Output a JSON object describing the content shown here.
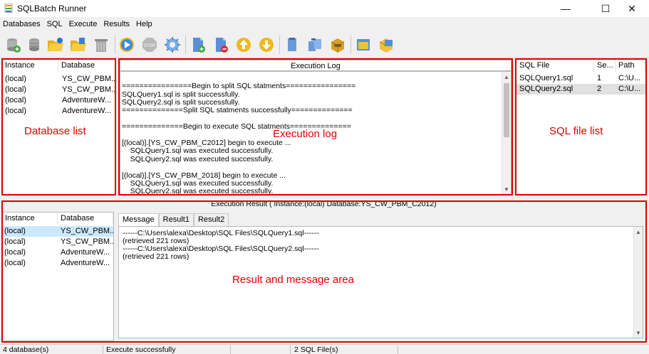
{
  "window": {
    "title": "SQLBatch Runner",
    "minimize": "—",
    "maximize": "☐",
    "close": "✕"
  },
  "menu": [
    "Databases",
    "SQL",
    "Execute",
    "Results",
    "Help"
  ],
  "database_list": {
    "headers": [
      "Instance",
      "Database"
    ],
    "rows": [
      [
        "(local)",
        "YS_CW_PBM..."
      ],
      [
        "(local)",
        "YS_CW_PBM..."
      ],
      [
        "(local)",
        "AdventureW..."
      ],
      [
        "(local)",
        "AdventureW..."
      ]
    ],
    "annotation": "Database list"
  },
  "execution_log": {
    "header": "Execution Log",
    "lines": [
      "================Begin to split SQL statments================",
      "SQLQuery1.sql is split successfully.",
      "SQLQuery2.sql is split successfully.",
      "==============Split SQL statments successfully==============",
      "",
      "==============Begin to execute SQL statments==============",
      "",
      "[(local)].[YS_CW_PBM_C2012] begin to execute ...",
      "    SQLQuery1.sql was executed successfully.",
      "    SQLQuery2.sql was executed successfully.",
      "",
      "[(local)].[YS_CW_PBM_2018] begin to execute ...",
      "    SQLQuery1.sql was executed successfully.",
      "    SQLQuery2.sql was executed successfully."
    ],
    "annotation": "Execution log"
  },
  "sql_files": {
    "headers": [
      "SQL File",
      "Se...",
      "Path"
    ],
    "rows": [
      [
        "SQLQuery1.sql",
        "1",
        "C:\\U..."
      ],
      [
        "SQLQuery2.sql",
        "2",
        "C:\\U..."
      ]
    ],
    "annotation": "SQL file list"
  },
  "result": {
    "header": "Execution Result ( Instance:(local)    Database:YS_CW_PBM_C2012)",
    "db_headers": [
      "Instance",
      "Database"
    ],
    "db_rows": [
      [
        "(local)",
        "YS_CW_PBM..."
      ],
      [
        "(local)",
        "YS_CW_PBM..."
      ],
      [
        "(local)",
        "AdventureW..."
      ],
      [
        "(local)",
        "AdventureW..."
      ]
    ],
    "tabs": [
      "Message",
      "Result1",
      "Result2"
    ],
    "messages": [
      "------C:\\Users\\alexa\\Desktop\\SQL Files\\SQLQuery1.sql------",
      "(retrieved 221 rows)",
      "------C:\\Users\\alexa\\Desktop\\SQL Files\\SQLQuery2.sql------",
      "(retrieved 221 rows)"
    ],
    "annotation": "Result and message area"
  },
  "status": {
    "databases": "4 database(s)",
    "execute": "Execute successfully",
    "files": "2 SQL File(s)"
  },
  "toolbar_icons": [
    "add-database-icon",
    "remove-database-icon",
    "open-folder-icon",
    "open-folder-sql-icon",
    "clear-icon",
    "run-icon",
    "stop-icon",
    "settings-icon",
    "add-sql-file-icon",
    "remove-sql-file-icon",
    "move-up-icon",
    "move-down-icon",
    "copy-icon",
    "paste-icon",
    "export-icon",
    "results-window-icon",
    "package-icon"
  ],
  "colors": {
    "annotation_red": "#e00000",
    "selection": "#cce8ff"
  }
}
